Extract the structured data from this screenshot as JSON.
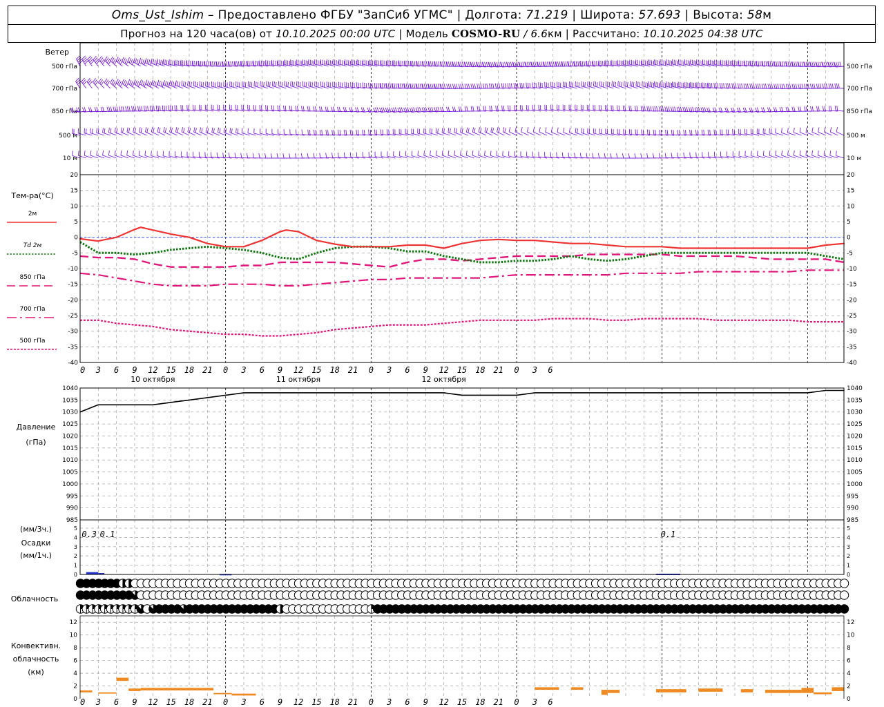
{
  "header": {
    "station": "Oms_Ust_Ishim",
    "dash": "–",
    "provider": "Предоставлено ФГБУ \"ЗапСиб УГМС\"",
    "lon_label": "Долгота:",
    "lon_value": "71.219",
    "lat_label": "Широта:",
    "lat_value": "57.693",
    "alt_label": "Высота:",
    "alt_value": "58",
    "alt_unit": "м",
    "sep": "|",
    "forecast_prefix": "Прогноз на 120 часа(ов) от",
    "init_time": "10.10.2025 00:00 UTC",
    "model_label": "Модель",
    "model_name": "COSMO-RU",
    "model_slash": "/",
    "model_res": "6.6",
    "model_res_unit": "км",
    "calc_label": "Рассчитано:",
    "calc_time": "10.10.2025 04:38 UTC"
  },
  "colors": {
    "wind": "#7a1fd8",
    "t2m": "#ee3333",
    "td2m": "#117711",
    "t850": "#e0167a",
    "t700": "#e0167a",
    "t500": "#e0167a",
    "zero_line": "#3355ee",
    "pressure": "#000000",
    "precip": "#2233cc",
    "convective": "#ee8a22",
    "grid": "#aaaaaa",
    "daybreak": "#000000"
  },
  "chart_data": {
    "type": "line",
    "x": {
      "start_hour": 0,
      "end_hour": 126,
      "tick_step_hours": 3,
      "tick_labels": [
        "0",
        "3",
        "6",
        "9",
        "12",
        "15",
        "18",
        "21",
        "0",
        "3",
        "6",
        "9",
        "12",
        "15",
        "18",
        "21",
        "0",
        "3",
        "6",
        "9",
        "12",
        "15",
        "18",
        "21",
        "0",
        "3",
        "6"
      ],
      "day_labels": [
        {
          "label": "10 октября",
          "hour": 12
        },
        {
          "label": "11 октября",
          "hour": 36
        },
        {
          "label": "12 октября",
          "hour": 60
        }
      ],
      "day_boundaries": [
        24,
        48,
        72,
        96,
        120
      ]
    },
    "wind": {
      "title": "Ветер",
      "levels": [
        "500 гПа",
        "700 гПа",
        "850 гПа",
        "500 м",
        "10 м"
      ],
      "icon": "wind-barb-icon"
    },
    "temperature": {
      "title": "Тем-ра(°C)",
      "ylim": [
        -40,
        20
      ],
      "yticks": [
        20,
        15,
        10,
        5,
        0,
        -5,
        -10,
        -15,
        -20,
        -25,
        -30,
        -35,
        -40
      ],
      "legend": [
        {
          "key": "t2m",
          "label": "2м",
          "style": "solid"
        },
        {
          "key": "td2m",
          "label": "Td  2м",
          "style": "dotted"
        },
        {
          "key": "t850",
          "label": "850 гПа",
          "style": "dash"
        },
        {
          "key": "t700",
          "label": "700 гПа",
          "style": "dashdot"
        },
        {
          "key": "t500",
          "label": "500 гПа",
          "style": "dot"
        }
      ],
      "series": {
        "t2m": {
          "x": [
            0,
            3,
            6,
            9,
            10,
            12,
            15,
            18,
            21,
            24,
            27,
            30,
            33,
            34,
            36,
            39,
            42,
            45,
            48,
            51,
            54,
            57,
            60,
            63,
            66,
            69,
            72,
            75,
            78,
            81,
            84,
            87,
            90,
            93,
            96,
            99,
            102,
            105,
            108,
            111,
            114,
            117,
            120,
            123,
            126
          ],
          "y": [
            -0.5,
            -1.2,
            0,
            2.5,
            3.2,
            2.3,
            1,
            0,
            -2,
            -3,
            -3,
            -1,
            1.8,
            2.3,
            1.8,
            -1,
            -2.2,
            -3,
            -3,
            -3,
            -2.5,
            -2.5,
            -3.5,
            -2,
            -1,
            -0.7,
            -1,
            -1,
            -1.5,
            -2,
            -2,
            -2.5,
            -3,
            -3,
            -3,
            -3.5,
            -3.5,
            -3.5,
            -3.5,
            -3.5,
            -3.5,
            -3.5,
            -3.5,
            -2.5,
            -2
          ]
        },
        "td2m": {
          "x": [
            0,
            3,
            6,
            9,
            12,
            15,
            18,
            21,
            24,
            27,
            30,
            33,
            36,
            39,
            42,
            45,
            48,
            51,
            54,
            57,
            60,
            63,
            66,
            69,
            72,
            75,
            78,
            81,
            84,
            87,
            90,
            93,
            96,
            99,
            102,
            105,
            108,
            111,
            114,
            117,
            120,
            123,
            126
          ],
          "y": [
            -1.5,
            -5,
            -5,
            -5.5,
            -5,
            -4,
            -3.5,
            -3,
            -3.5,
            -4,
            -5,
            -6.5,
            -7,
            -5,
            -3.5,
            -3,
            -3,
            -3.5,
            -4.5,
            -4.5,
            -6,
            -7,
            -8,
            -8,
            -7.5,
            -7.5,
            -7,
            -6,
            -7,
            -7.5,
            -7,
            -6,
            -5,
            -5,
            -5,
            -5,
            -5,
            -5,
            -5,
            -5,
            -5,
            -6,
            -7
          ]
        },
        "t850": {
          "x": [
            0,
            3,
            6,
            9,
            12,
            15,
            18,
            21,
            24,
            27,
            30,
            33,
            36,
            39,
            42,
            45,
            48,
            51,
            54,
            57,
            60,
            63,
            66,
            69,
            72,
            75,
            78,
            81,
            84,
            87,
            90,
            93,
            96,
            99,
            102,
            105,
            108,
            111,
            114,
            117,
            120,
            123,
            126
          ],
          "y": [
            -6,
            -6.5,
            -6.5,
            -7,
            -8.5,
            -9.5,
            -9.5,
            -9.5,
            -9.5,
            -9,
            -9,
            -8,
            -8,
            -8,
            -8,
            -8.5,
            -9,
            -9.5,
            -8,
            -7,
            -7,
            -7.5,
            -7,
            -6.5,
            -6,
            -6,
            -6,
            -6,
            -5.5,
            -5.5,
            -5.5,
            -5.5,
            -5.5,
            -6,
            -6,
            -6,
            -6,
            -6.5,
            -7,
            -7,
            -7,
            -7,
            -8
          ]
        },
        "t700": {
          "x": [
            0,
            3,
            6,
            9,
            12,
            15,
            18,
            21,
            24,
            27,
            30,
            33,
            36,
            39,
            42,
            45,
            48,
            51,
            54,
            57,
            60,
            63,
            66,
            69,
            72,
            75,
            78,
            81,
            84,
            87,
            90,
            93,
            96,
            99,
            102,
            105,
            108,
            111,
            114,
            117,
            120,
            123,
            126
          ],
          "y": [
            -11.5,
            -12,
            -13,
            -14,
            -15,
            -15.5,
            -15.5,
            -15.5,
            -15,
            -15,
            -15,
            -15.5,
            -15.5,
            -15,
            -14.5,
            -14,
            -13.5,
            -13.5,
            -13,
            -13,
            -13,
            -13,
            -13,
            -12.5,
            -12,
            -12,
            -12,
            -12,
            -12,
            -12,
            -11.5,
            -11.5,
            -11.5,
            -11.5,
            -11,
            -11,
            -11,
            -11,
            -11,
            -11,
            -10.5,
            -10.5,
            -10.5
          ]
        },
        "t500": {
          "x": [
            0,
            3,
            6,
            9,
            12,
            15,
            18,
            21,
            24,
            27,
            30,
            33,
            36,
            39,
            42,
            45,
            48,
            51,
            54,
            57,
            60,
            63,
            66,
            69,
            72,
            75,
            78,
            81,
            84,
            87,
            90,
            93,
            96,
            99,
            102,
            105,
            108,
            111,
            114,
            117,
            120,
            123,
            126
          ],
          "y": [
            -26.5,
            -26.5,
            -27.5,
            -28,
            -28.5,
            -29.5,
            -30,
            -30.5,
            -31,
            -31,
            -31.5,
            -31.5,
            -31,
            -30.5,
            -29.5,
            -29,
            -28.5,
            -28,
            -28,
            -28,
            -27.5,
            -27,
            -26.5,
            -26.5,
            -26.5,
            -26.5,
            -26,
            -26,
            -26,
            -26.5,
            -26.5,
            -26,
            -26,
            -26,
            -26,
            -26.5,
            -26.5,
            -26.5,
            -26.5,
            -26.5,
            -27,
            -27,
            -27
          ]
        }
      }
    },
    "pressure": {
      "title": "Давление",
      "unit": "(гПа)",
      "ylim": [
        985,
        1040
      ],
      "yticks": [
        1040,
        1035,
        1030,
        1025,
        1020,
        1015,
        1010,
        1005,
        1000,
        995,
        990,
        985
      ],
      "x": [
        0,
        3,
        6,
        9,
        12,
        15,
        18,
        21,
        24,
        27,
        30,
        33,
        36,
        39,
        42,
        45,
        48,
        51,
        54,
        57,
        60,
        63,
        66,
        69,
        72,
        75,
        78,
        81,
        84,
        87,
        90,
        93,
        96,
        99,
        102,
        105,
        108,
        111,
        114,
        117,
        120,
        123,
        126
      ],
      "y": [
        1030,
        1033,
        1033,
        1033,
        1033,
        1034,
        1035,
        1036,
        1037,
        1038,
        1038,
        1038,
        1038,
        1038,
        1038,
        1038,
        1038,
        1038,
        1038,
        1038,
        1038,
        1037,
        1037,
        1037,
        1037,
        1038,
        1038,
        1038,
        1038,
        1038,
        1038,
        1038,
        1038,
        1038,
        1038,
        1038,
        1038,
        1038,
        1038,
        1038,
        1038,
        1039,
        1039
      ]
    },
    "precip": {
      "title": "Осадки",
      "unit_top": "(мм/3ч.)",
      "unit_bottom": "(мм/1ч.)",
      "ylim": [
        0,
        5
      ],
      "yticks": [
        5,
        4,
        3,
        2,
        1,
        0
      ],
      "bars": [
        {
          "from": 1,
          "to": 3,
          "value": 0.25
        },
        {
          "from": 3,
          "to": 4,
          "value": 0.15
        },
        {
          "from": 23,
          "to": 25,
          "value": 0.05
        },
        {
          "from": 95,
          "to": 99,
          "value": 0.08
        }
      ],
      "annotations": [
        {
          "hour": 1.5,
          "text": "0.3"
        },
        {
          "hour": 4.5,
          "text": "0.1"
        },
        {
          "hour": 97,
          "text": "0.1"
        }
      ]
    },
    "clouds": {
      "title": "Облачность",
      "step_hours": 1,
      "rows": [
        "88888886500000000000000000000000000000000000000000000000000000000000000000000000000000000000000000000000000000000000000000000000",
        "88888888870000000000000000000000000000000000000000000000000000000000000000000000000000000000000000000000000000000000000000000000",
        "44444444447278888788888888888888860000000000000048888888888888888888888888888888888888888888888888888888888888888888888888888888"
      ],
      "icon": "cloud-cover-icon"
    },
    "convective": {
      "title": "Конвективн.",
      "title2": "облачность",
      "unit": "(км)",
      "ylim": [
        0,
        13
      ],
      "yticks": [
        12,
        10,
        8,
        6,
        4,
        2,
        0
      ],
      "segments": [
        {
          "from": 0,
          "to": 2,
          "bottom": 1.0,
          "top": 1.3
        },
        {
          "from": 3,
          "to": 6,
          "bottom": 0.8,
          "top": 1.0
        },
        {
          "from": 6,
          "to": 8,
          "bottom": 2.8,
          "top": 3.3
        },
        {
          "from": 8,
          "to": 10,
          "bottom": 1.2,
          "top": 1.6
        },
        {
          "from": 10,
          "to": 16,
          "bottom": 1.3,
          "top": 1.7
        },
        {
          "from": 16,
          "to": 22,
          "bottom": 1.3,
          "top": 1.7
        },
        {
          "from": 22,
          "to": 25,
          "bottom": 0.7,
          "top": 0.9
        },
        {
          "from": 25,
          "to": 29,
          "bottom": 0.5,
          "top": 0.8
        },
        {
          "from": 75,
          "to": 79,
          "bottom": 1.4,
          "top": 1.8
        },
        {
          "from": 81,
          "to": 83,
          "bottom": 1.4,
          "top": 1.8
        },
        {
          "from": 86,
          "to": 87,
          "bottom": 0.6,
          "top": 1.4
        },
        {
          "from": 87,
          "to": 89,
          "bottom": 0.9,
          "top": 1.4
        },
        {
          "from": 95,
          "to": 100,
          "bottom": 1.0,
          "top": 1.5
        },
        {
          "from": 102,
          "to": 106,
          "bottom": 1.1,
          "top": 1.6
        },
        {
          "from": 109,
          "to": 111,
          "bottom": 1.0,
          "top": 1.5
        },
        {
          "from": 113,
          "to": 119,
          "bottom": 0.9,
          "top": 1.4
        },
        {
          "from": 119,
          "to": 121,
          "bottom": 0.9,
          "top": 1.7
        },
        {
          "from": 121,
          "to": 124,
          "bottom": 0.7,
          "top": 1.0
        },
        {
          "from": 124,
          "to": 126,
          "bottom": 1.2,
          "top": 1.8
        }
      ]
    }
  }
}
